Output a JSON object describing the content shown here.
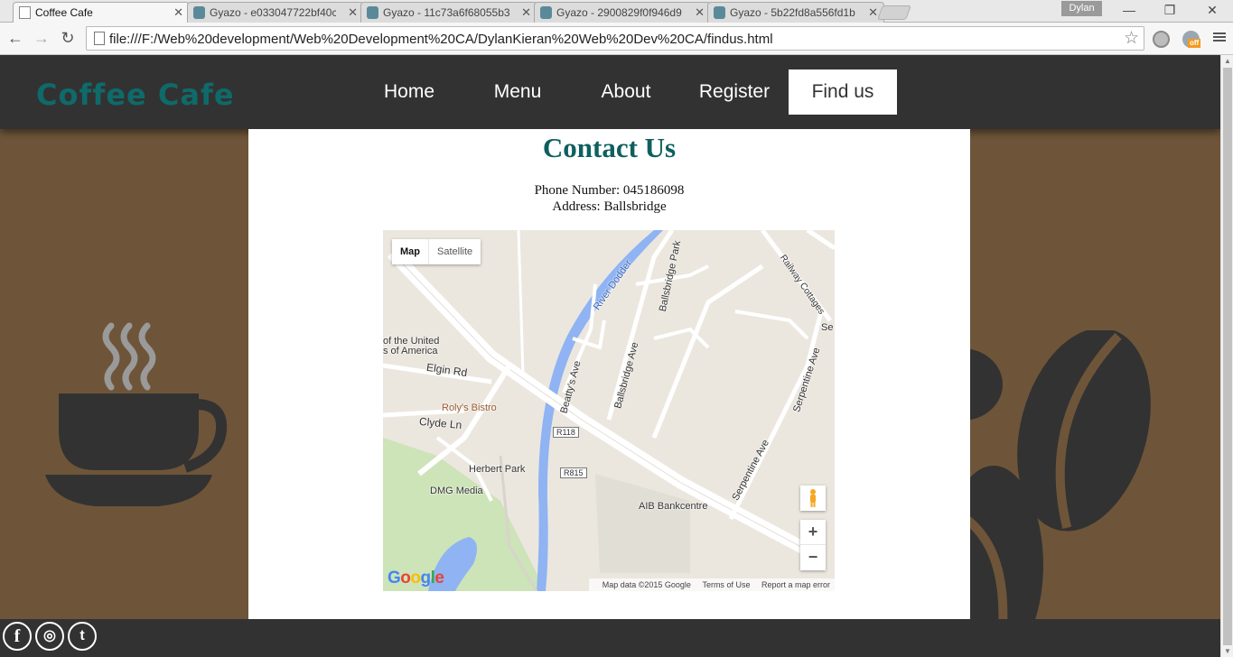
{
  "browser": {
    "tabs": [
      {
        "title": "Coffee Cafe",
        "active": true
      },
      {
        "title": "Gyazo - e033047722bf40c",
        "active": false
      },
      {
        "title": "Gyazo - 11c73a6f68055b3",
        "active": false
      },
      {
        "title": "Gyazo - 2900829f0f946d9",
        "active": false
      },
      {
        "title": "Gyazo - 5b22fd8a556fd1b",
        "active": false
      }
    ],
    "profile_name": "Dylan",
    "url": "file:///F:/Web%20development/Web%20Development%20CA/DylanKieran%20Web%20Dev%20CA/findus.html",
    "extension_badge": "off"
  },
  "site": {
    "logo": "Coffee Cafe",
    "nav": [
      {
        "label": "Home",
        "active": false
      },
      {
        "label": "Menu",
        "active": false
      },
      {
        "label": "About",
        "active": false
      },
      {
        "label": "Register",
        "active": false
      },
      {
        "label": "Find us",
        "active": true
      }
    ],
    "heading": "Contact Us",
    "phone": "Phone Number: 045186098",
    "address": "Address: Ballsbridge"
  },
  "map": {
    "type_map": "Map",
    "type_satellite": "Satellite",
    "zoom_in": "+",
    "zoom_out": "−",
    "logo": "Google",
    "attribution": "Map data ©2015 Google",
    "terms": "Terms of Use",
    "report": "Report a map error",
    "labels": [
      "River Dodder",
      "Ballsbridge Park",
      "Railway Cottages",
      "of the United",
      "s of America",
      "Elgin Rd",
      "Beatty's Ave",
      "Ballsbridge Ave",
      "Roly's Bistro",
      "Clyde Ln",
      "R118",
      "R815",
      "Herbert Park",
      "DMG Media",
      "AIB Bankcentre",
      "Serpentine Ave",
      "Serpentine Ave",
      "Se"
    ]
  },
  "footer": {
    "social": [
      {
        "icon": "facebook-icon",
        "glyph": "f"
      },
      {
        "icon": "instagram-icon",
        "glyph": "◎"
      },
      {
        "icon": "twitter-icon",
        "glyph": "t"
      }
    ]
  },
  "colors": {
    "header_bg": "#323232",
    "page_bg": "#6e5539",
    "logo": "#0f6a6a",
    "heading": "#0f5f5f"
  }
}
